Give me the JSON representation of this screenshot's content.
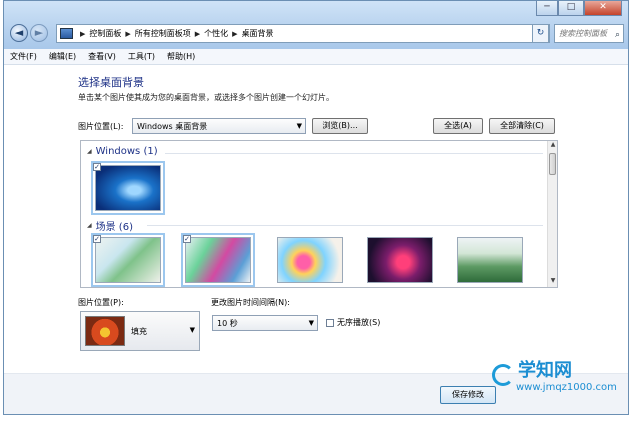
{
  "window": {
    "controls": {
      "minimize": "─",
      "maximize": "□",
      "close": "✕"
    }
  },
  "navigation": {
    "back_icon": "back-arrow-icon",
    "forward_icon": "forward-arrow-icon",
    "back_glyph": "◄",
    "forward_glyph": "►",
    "breadcrumb": [
      "控制面板",
      "所有控制面板项",
      "个性化",
      "桌面背景"
    ],
    "search_placeholder": "搜索控制面板",
    "refresh_glyph": "↻",
    "search_glyph": "⌕"
  },
  "menubar": {
    "items": [
      "文件(F)",
      "编辑(E)",
      "查看(V)",
      "工具(T)",
      "帮助(H)"
    ]
  },
  "main": {
    "title": "选择桌面背景",
    "subtitle": "单击某个图片使其成为您的桌面背景，或选择多个图片创建一个幻灯片。",
    "picture_location_label": "图片位置(L):",
    "picture_location_value": "Windows 桌面背景",
    "browse_button": "浏览(B)...",
    "select_all_button": "全选(A)",
    "clear_all_button": "全部清除(C)",
    "groups": [
      {
        "name": "Windows (1)"
      },
      {
        "name": "场景 (6)"
      }
    ],
    "picture_position_label": "图片位置(P):",
    "picture_position_value": "填充",
    "change_interval_label": "更改图片时间间隔(N):",
    "change_interval_value": "10 秒",
    "shuffle_label": "无序播放(S)",
    "save_button": "保存修改"
  },
  "watermark": {
    "brand": "学知网",
    "url": "www.jmqz1000.com"
  },
  "colors": {
    "title_blue": "#1e3287",
    "chrome_blue": "#b6d1ee",
    "selection_blue": "#9cc7ee",
    "watermark_blue": "#1c8ed2"
  }
}
